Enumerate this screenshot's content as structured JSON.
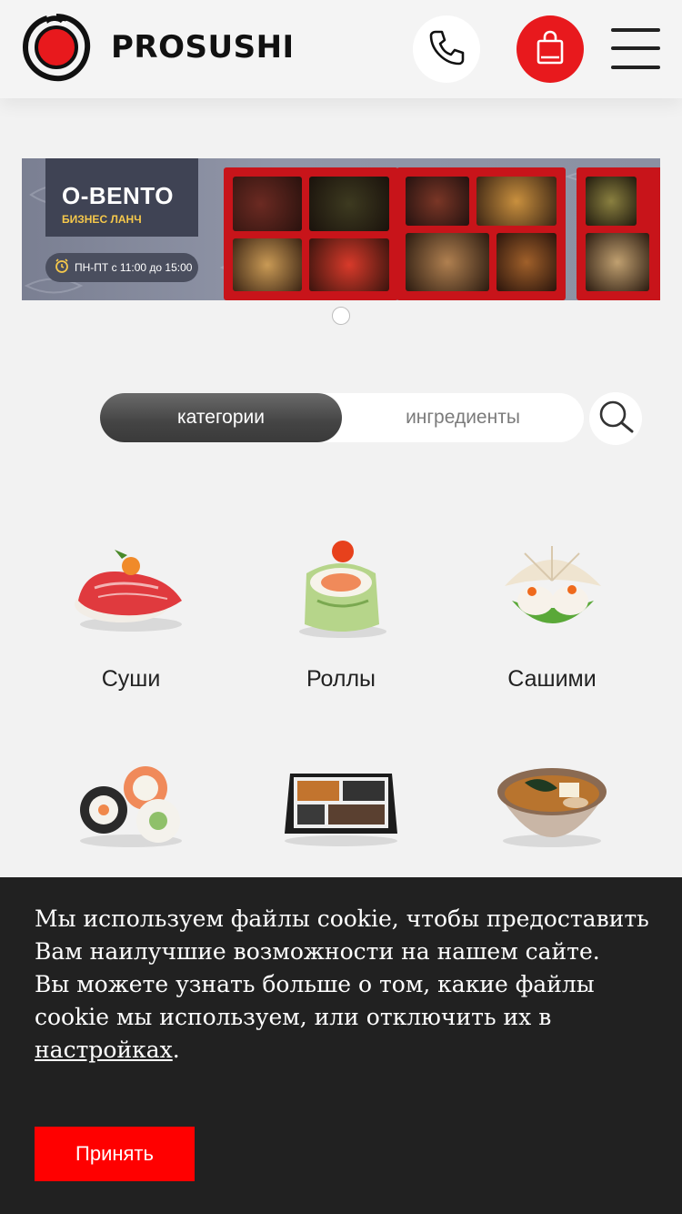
{
  "header": {
    "brand": "PROSUSHI",
    "phone_icon": "phone-icon",
    "cart_icon": "shopping-bag-icon",
    "menu_icon": "hamburger-menu-icon",
    "accent": "#e8191d"
  },
  "banner": {
    "title": "O-BENTO",
    "subtitle": "БИЗНЕС ЛАНЧ",
    "hours": "ПН-ПТ с 11:00 до 15:00",
    "clock_icon": "alarm-clock-icon",
    "subtitle_color": "#f5c84b"
  },
  "tabs": {
    "active": "категории",
    "inactive": "ингредиенты",
    "search_icon": "search-icon"
  },
  "categories": [
    {
      "label": "Суши"
    },
    {
      "label": "Роллы"
    },
    {
      "label": "Сашими"
    },
    {
      "label": ""
    },
    {
      "label": ""
    },
    {
      "label": ""
    }
  ],
  "cookie": {
    "text_1": "Мы используем файлы cookie, чтобы предоставить Вам наилучшие возможности на нашем сайте.",
    "text_2": "Вы можете узнать больше о том, какие файлы cookie мы используем, или отключить их в ",
    "link": "настройках",
    "end": ".",
    "accept": "Принять",
    "accent": "#ff0000"
  }
}
